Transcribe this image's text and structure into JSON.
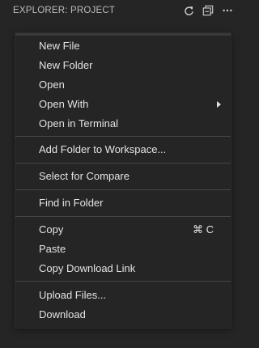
{
  "header": {
    "title": "EXPLORER: PROJECT",
    "actions": [
      {
        "icon": "refresh-icon"
      },
      {
        "icon": "collapse-all-icon"
      },
      {
        "icon": "more-icon"
      }
    ]
  },
  "menu": {
    "new_file": "New File",
    "new_folder": "New Folder",
    "open": "Open",
    "open_with": "Open With",
    "open_in_terminal": "Open in Terminal",
    "add_folder_to_workspace": "Add Folder to Workspace...",
    "select_for_compare": "Select for Compare",
    "find_in_folder": "Find in Folder",
    "copy": "Copy",
    "copy_shortcut": "⌘ C",
    "paste": "Paste",
    "copy_download_link": "Copy Download Link",
    "upload_files": "Upload Files...",
    "download": "Download"
  },
  "colors": {
    "panel_background": "#252526",
    "menu_text": "#e3e3e3",
    "header_text": "#bbbbbb",
    "separator": "#454545"
  }
}
